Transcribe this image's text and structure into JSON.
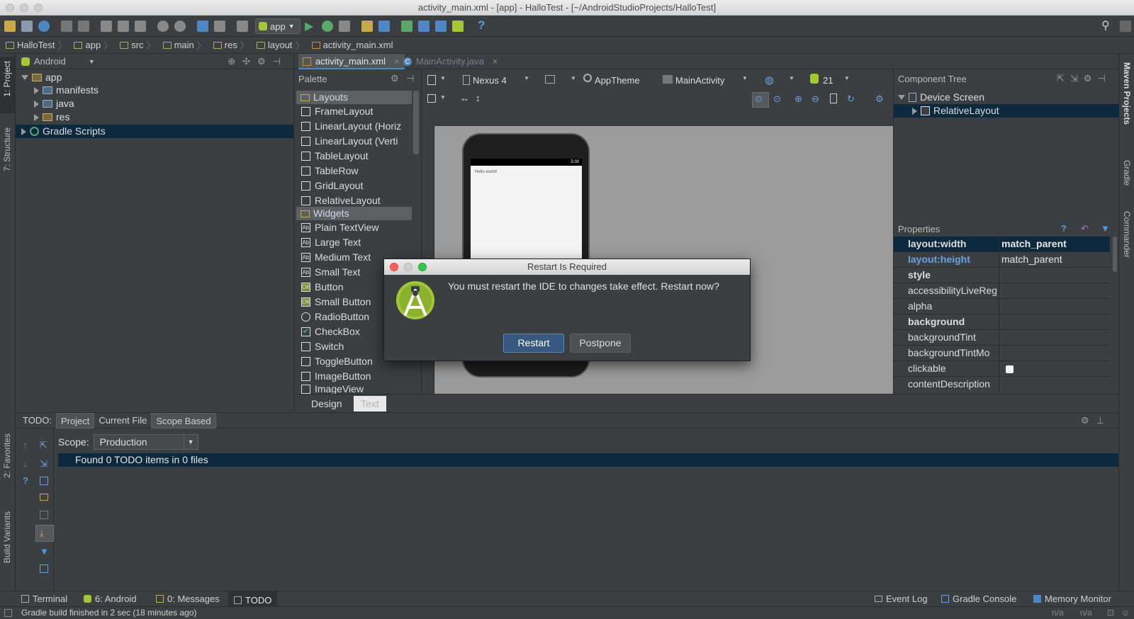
{
  "window": {
    "title": "activity_main.xml - [app] - HalloTest - [~/AndroidStudioProjects/HalloTest]"
  },
  "toolbar": {
    "run_config": "app"
  },
  "breadcrumb": [
    "HalloTest",
    "app",
    "src",
    "main",
    "res",
    "layout",
    "activity_main.xml"
  ],
  "left_strip": {
    "project": "1: Project",
    "structure": "7: Structure",
    "favorites": "2: Favorites",
    "build_variants": "Build Variants"
  },
  "right_strip": {
    "maven": "Maven Projects",
    "gradle": "Gradle",
    "commander": "Commander"
  },
  "project_panel": {
    "view_mode": "Android",
    "tree": [
      {
        "label": "app",
        "expanded": true
      },
      {
        "label": "manifests"
      },
      {
        "label": "java"
      },
      {
        "label": "res"
      },
      {
        "label": "Gradle Scripts",
        "selected": true
      }
    ]
  },
  "editor_tabs": [
    {
      "label": "activity_main.xml",
      "active": true
    },
    {
      "label": "MainActivity.java",
      "active": false
    }
  ],
  "palette": {
    "title": "Palette",
    "groups": [
      {
        "label": "Layouts",
        "items": [
          "FrameLayout",
          "LinearLayout (Horiz",
          "LinearLayout (Verti",
          "TableLayout",
          "TableRow",
          "GridLayout",
          "RelativeLayout"
        ]
      },
      {
        "label": "Widgets",
        "items": [
          "Plain TextView",
          "Large Text",
          "Medium Text",
          "Small Text",
          "Button",
          "Small Button",
          "RadioButton",
          "CheckBox",
          "Switch",
          "ToggleButton",
          "ImageButton",
          "ImageView"
        ]
      }
    ]
  },
  "design_toolbar": {
    "device": "Nexus 4",
    "theme": "AppTheme",
    "activity": "MainActivity",
    "api": "21"
  },
  "phone_preview": {
    "hello_text": "Hello world!",
    "clock": "5:00"
  },
  "design_tabs": {
    "design": "Design",
    "text": "Text"
  },
  "component_tree": {
    "title": "Component Tree",
    "root": "Device Screen",
    "child": "RelativeLayout"
  },
  "properties": {
    "title": "Properties",
    "rows": [
      {
        "name": "layout:width",
        "value": "match_parent"
      },
      {
        "name": "layout:height",
        "value": "match_parent"
      },
      {
        "name": "style",
        "value": ""
      },
      {
        "name": "accessibilityLiveReg",
        "value": ""
      },
      {
        "name": "alpha",
        "value": ""
      },
      {
        "name": "background",
        "value": ""
      },
      {
        "name": "backgroundTint",
        "value": ""
      },
      {
        "name": "backgroundTintMo",
        "value": ""
      },
      {
        "name": "clickable",
        "value": ""
      },
      {
        "name": "contentDescription",
        "value": ""
      }
    ]
  },
  "dialog": {
    "title": "Restart Is Required",
    "message": "You must restart the IDE to changes take effect. Restart now?",
    "restart": "Restart",
    "postpone": "Postpone"
  },
  "todo": {
    "label": "TODO:",
    "tabs": [
      "Project",
      "Current File",
      "Scope Based"
    ],
    "scope_label": "Scope:",
    "scope_value": "Production",
    "result": "Found 0 TODO items in 0 files"
  },
  "bottom_tabs": {
    "terminal": "Terminal",
    "android": "6: Android",
    "messages": "0: Messages",
    "todo": "TODO",
    "event_log": "Event Log",
    "gradle_console": "Gradle Console",
    "memory_monitor": "Memory Monitor"
  },
  "status": {
    "message": "Gradle build finished in 2 sec (18 minutes ago)",
    "pos1": "n/a",
    "pos2": "n/a"
  },
  "colors": {
    "accent": "#0d293e",
    "android_green": "#a4c639",
    "selection_blue": "#2f65ca"
  }
}
